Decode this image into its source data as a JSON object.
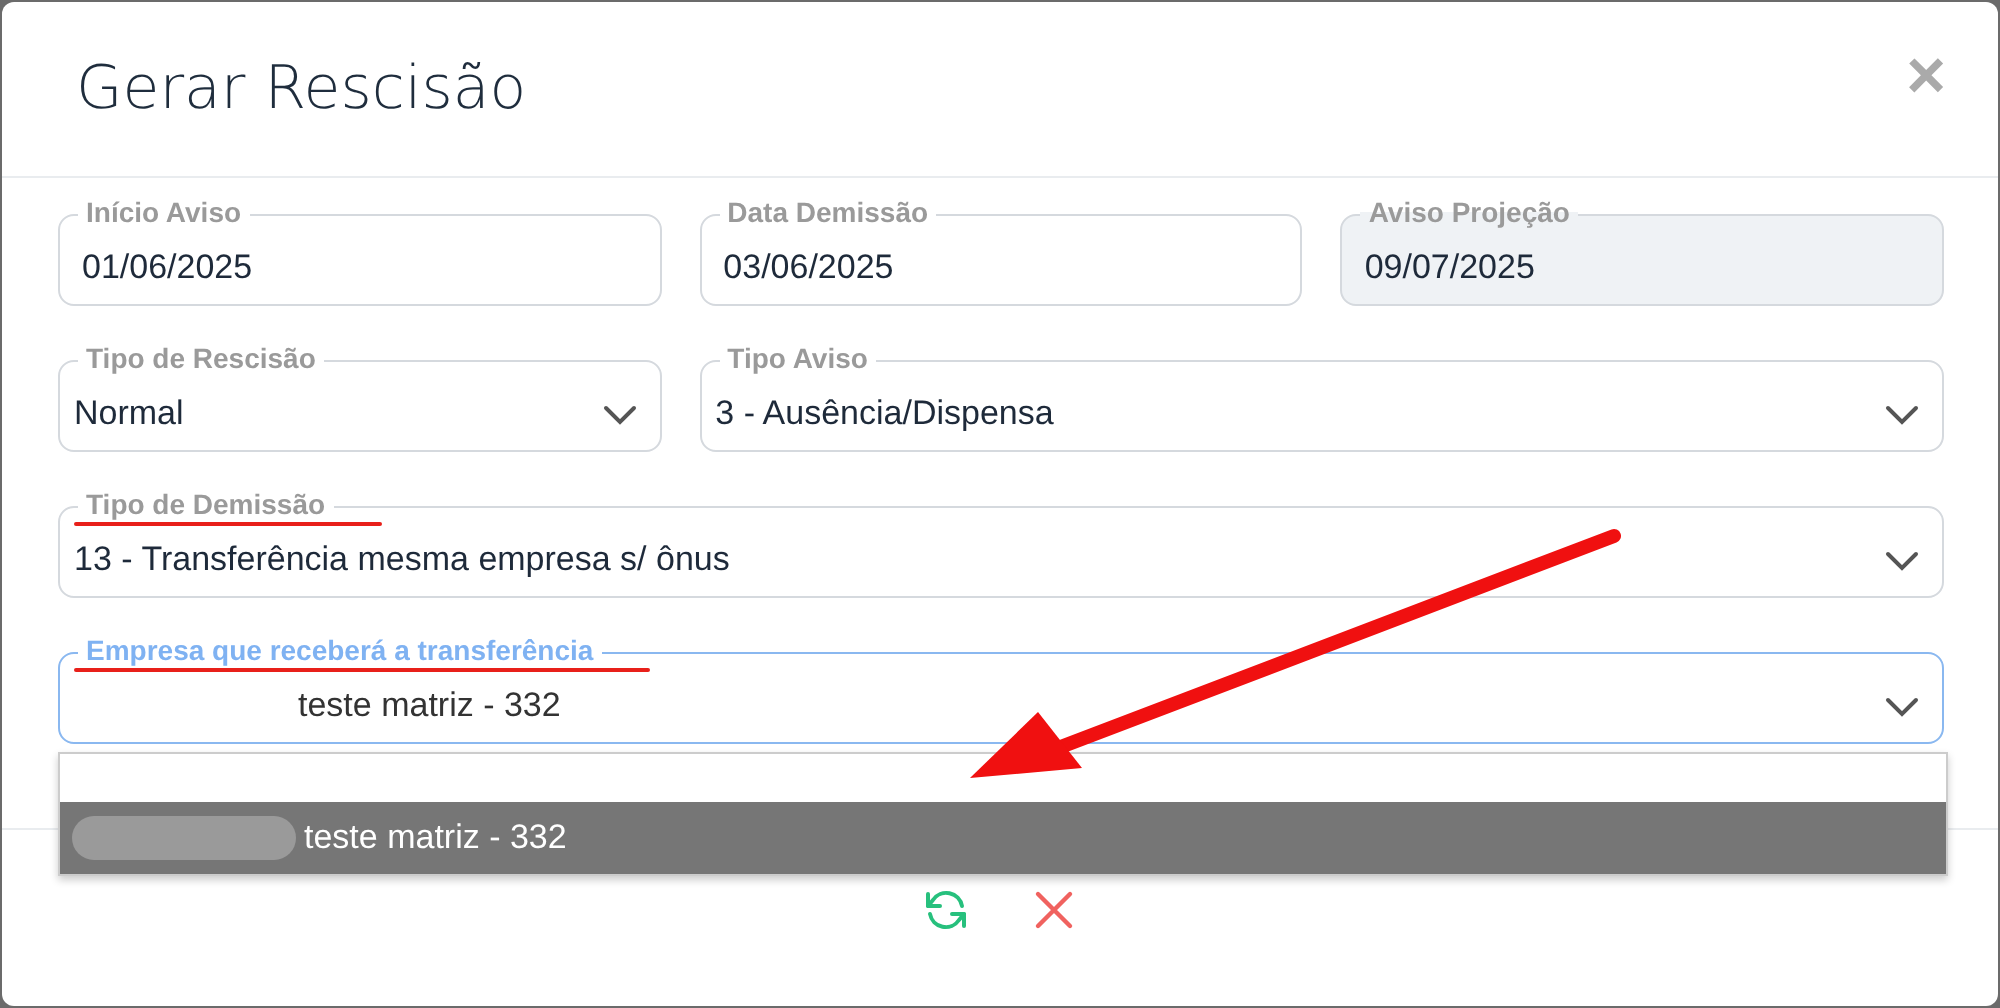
{
  "dialog": {
    "title": "Gerar Rescisão",
    "close": "×"
  },
  "rows": [
    {
      "fields": [
        {
          "kind": "text",
          "label": "Início Aviso",
          "value": "01/06/2025",
          "disabled": false,
          "focused": false,
          "underlined": false
        },
        {
          "kind": "text",
          "label": "Data Demissão",
          "value": "03/06/2025",
          "disabled": false,
          "focused": false,
          "underlined": false
        },
        {
          "kind": "text",
          "label": "Aviso Projeção",
          "value": "09/07/2025",
          "disabled": true,
          "focused": false,
          "underlined": false
        }
      ]
    },
    {
      "fields": [
        {
          "kind": "select",
          "label": "Tipo de Rescisão",
          "value": "Normal",
          "disabled": false,
          "focused": false,
          "underlined": false
        },
        {
          "kind": "select",
          "label": "Tipo Aviso",
          "value": "3 - Ausência/Dispensa",
          "disabled": false,
          "focused": false,
          "underlined": false
        }
      ]
    },
    {
      "fields": [
        {
          "kind": "select",
          "label": "Tipo de Demissão",
          "value": "13 - Transferência mesma empresa s/ ônus",
          "disabled": false,
          "focused": false,
          "underlined": true
        }
      ]
    },
    {
      "fields": [
        {
          "kind": "select",
          "label": "Empresa que receberá a transferência",
          "value": "teste matriz - 332",
          "redacted": true,
          "disabled": false,
          "focused": true,
          "underlined": true
        }
      ]
    }
  ],
  "dropdown": {
    "options": [
      {
        "selected": false
      },
      {
        "label": "teste matriz - 332",
        "redacted": true,
        "selected": true
      }
    ]
  },
  "footer": {
    "buttons": [
      {
        "kind": "refresh"
      },
      {
        "kind": "cancel"
      }
    ]
  }
}
